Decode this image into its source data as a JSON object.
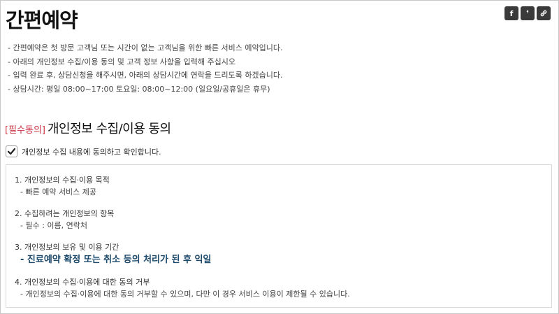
{
  "page": {
    "title": "간편예약"
  },
  "share": {
    "buttons": [
      {
        "label": "f",
        "icon": "facebook-icon"
      },
      {
        "label": "❜",
        "icon": "kakao-story-icon"
      },
      {
        "label": "",
        "icon": "link-icon"
      }
    ]
  },
  "notices": [
    "- 간편예약은 첫 방문 고객님 또는 시간이 없는 고객님을 위한 빠른 서비스 예약입니다.",
    "- 아래의 개인정보 수집/이용 동의 및 고객 정보 사항을 입력해 주십시오",
    "- 입력 완료 후, 상담신청을 해주시면, 아래의 상담시간에 연락을 드리도록 하겠습니다.",
    "- 상담시간: 평일 08:00~17:00 토요일: 08:00~12:00 (일요일/공휴일은 휴무)"
  ],
  "consent": {
    "prefix": "[필수동의]",
    "heading": "개인정보 수집/이용 동의",
    "checkbox_label": "개인정보 수집 내용에 동의하고 확인합니다.",
    "checked": true
  },
  "terms": [
    {
      "heading": "1. 개인정보의 수집·이용 목적",
      "detail": "- 빠른 예약 서비스 제공"
    },
    {
      "heading": "2. 수집하려는 개인정보의 항목",
      "detail": "- 필수 : 이름, 연락처"
    },
    {
      "heading": "3. 개인정보의 보유 및 이용 기간",
      "detail": "- 진료예약 확정 또는 취소 등의 처리가 된 후 익일"
    },
    {
      "heading": "4. 개인정보의 수집·이용에 대한 동의 거부",
      "detail": "- 개인정보의 수집·이용에 대한 동의 거부할 수 있으며, 다만 이 경우 서비스 이용이 제한될 수 있습니다."
    }
  ],
  "colors": {
    "required_prefix": "#cc3344",
    "emphasis_text": "#1d4a6b",
    "share_button_bg": "#3a3a3a"
  }
}
